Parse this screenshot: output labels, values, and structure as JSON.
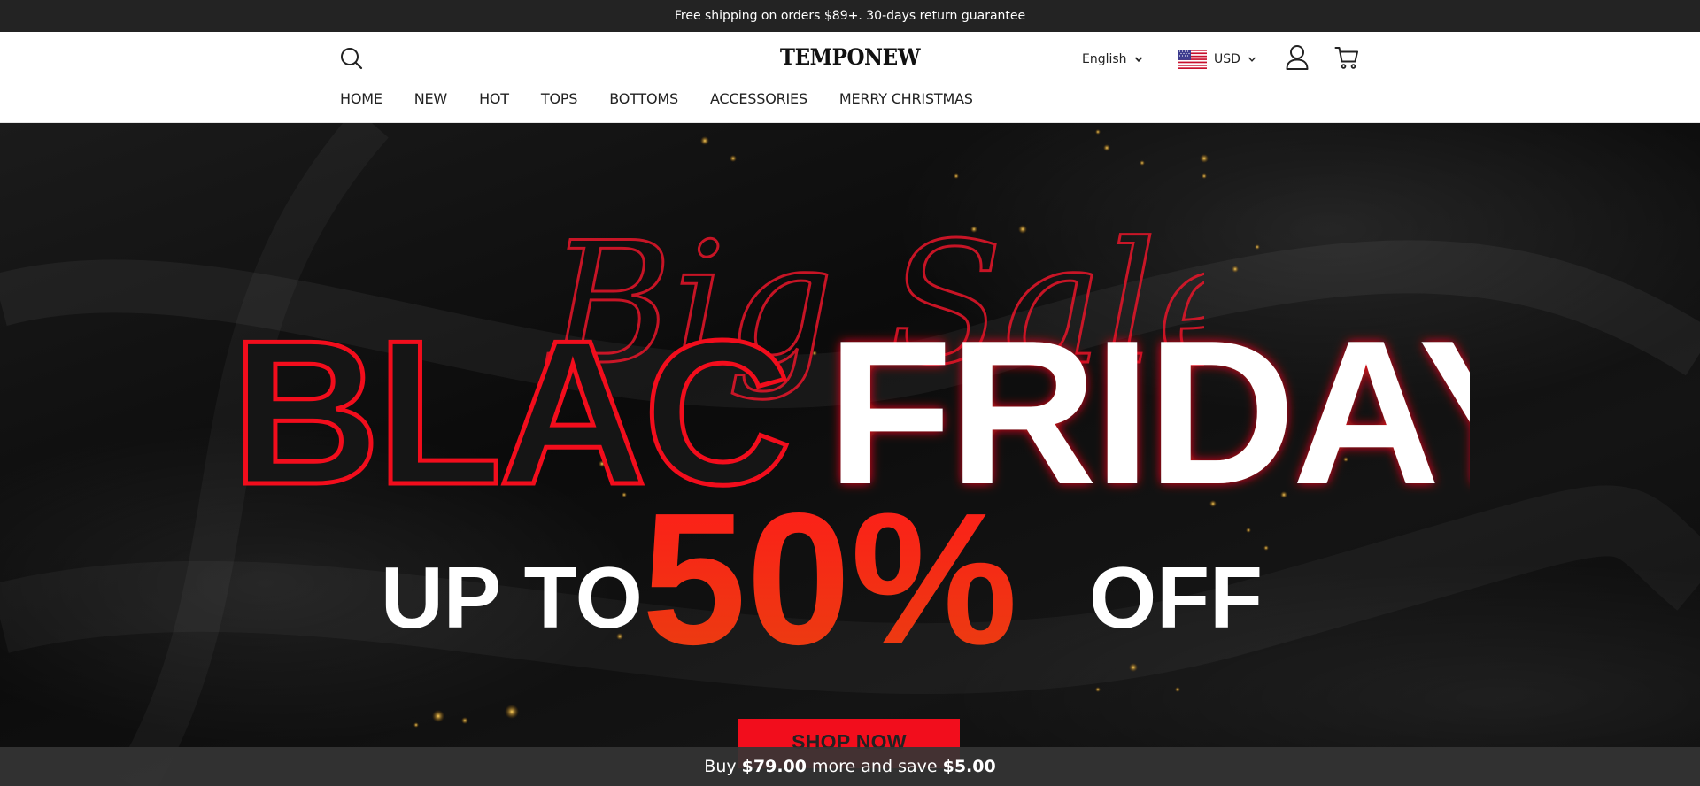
{
  "announcement": {
    "text": "Free shipping on orders $89+. 30-days return guarantee"
  },
  "header": {
    "logo": "TEMPONEW",
    "language": "English",
    "currency": "USD",
    "icons": {
      "search": "search-icon",
      "account": "user-icon",
      "cart": "cart-icon",
      "flag": "us-flag-icon"
    }
  },
  "nav": {
    "items": [
      {
        "label": "HOME"
      },
      {
        "label": "NEW"
      },
      {
        "label": "HOT"
      },
      {
        "label": "TOPS"
      },
      {
        "label": "BOTTOMS"
      },
      {
        "label": "ACCESSORIES"
      },
      {
        "label": "MERRY CHRISTMAS"
      }
    ]
  },
  "hero": {
    "script_text": "Big Sale",
    "headline_left": "BLACK",
    "headline_right": "FRIDAY",
    "promo_prefix": "UP TO",
    "promo_value": "50%",
    "promo_suffix": "OFF",
    "cta_label": "SHOP NOW",
    "colors": {
      "accent_red": "#f20d1c",
      "dark_fill": "#151515",
      "white": "#ffffff"
    }
  },
  "offer_bar": {
    "prefix": "Buy ",
    "threshold": "$79.00",
    "middle": " more and save ",
    "saving": "$5.00"
  }
}
